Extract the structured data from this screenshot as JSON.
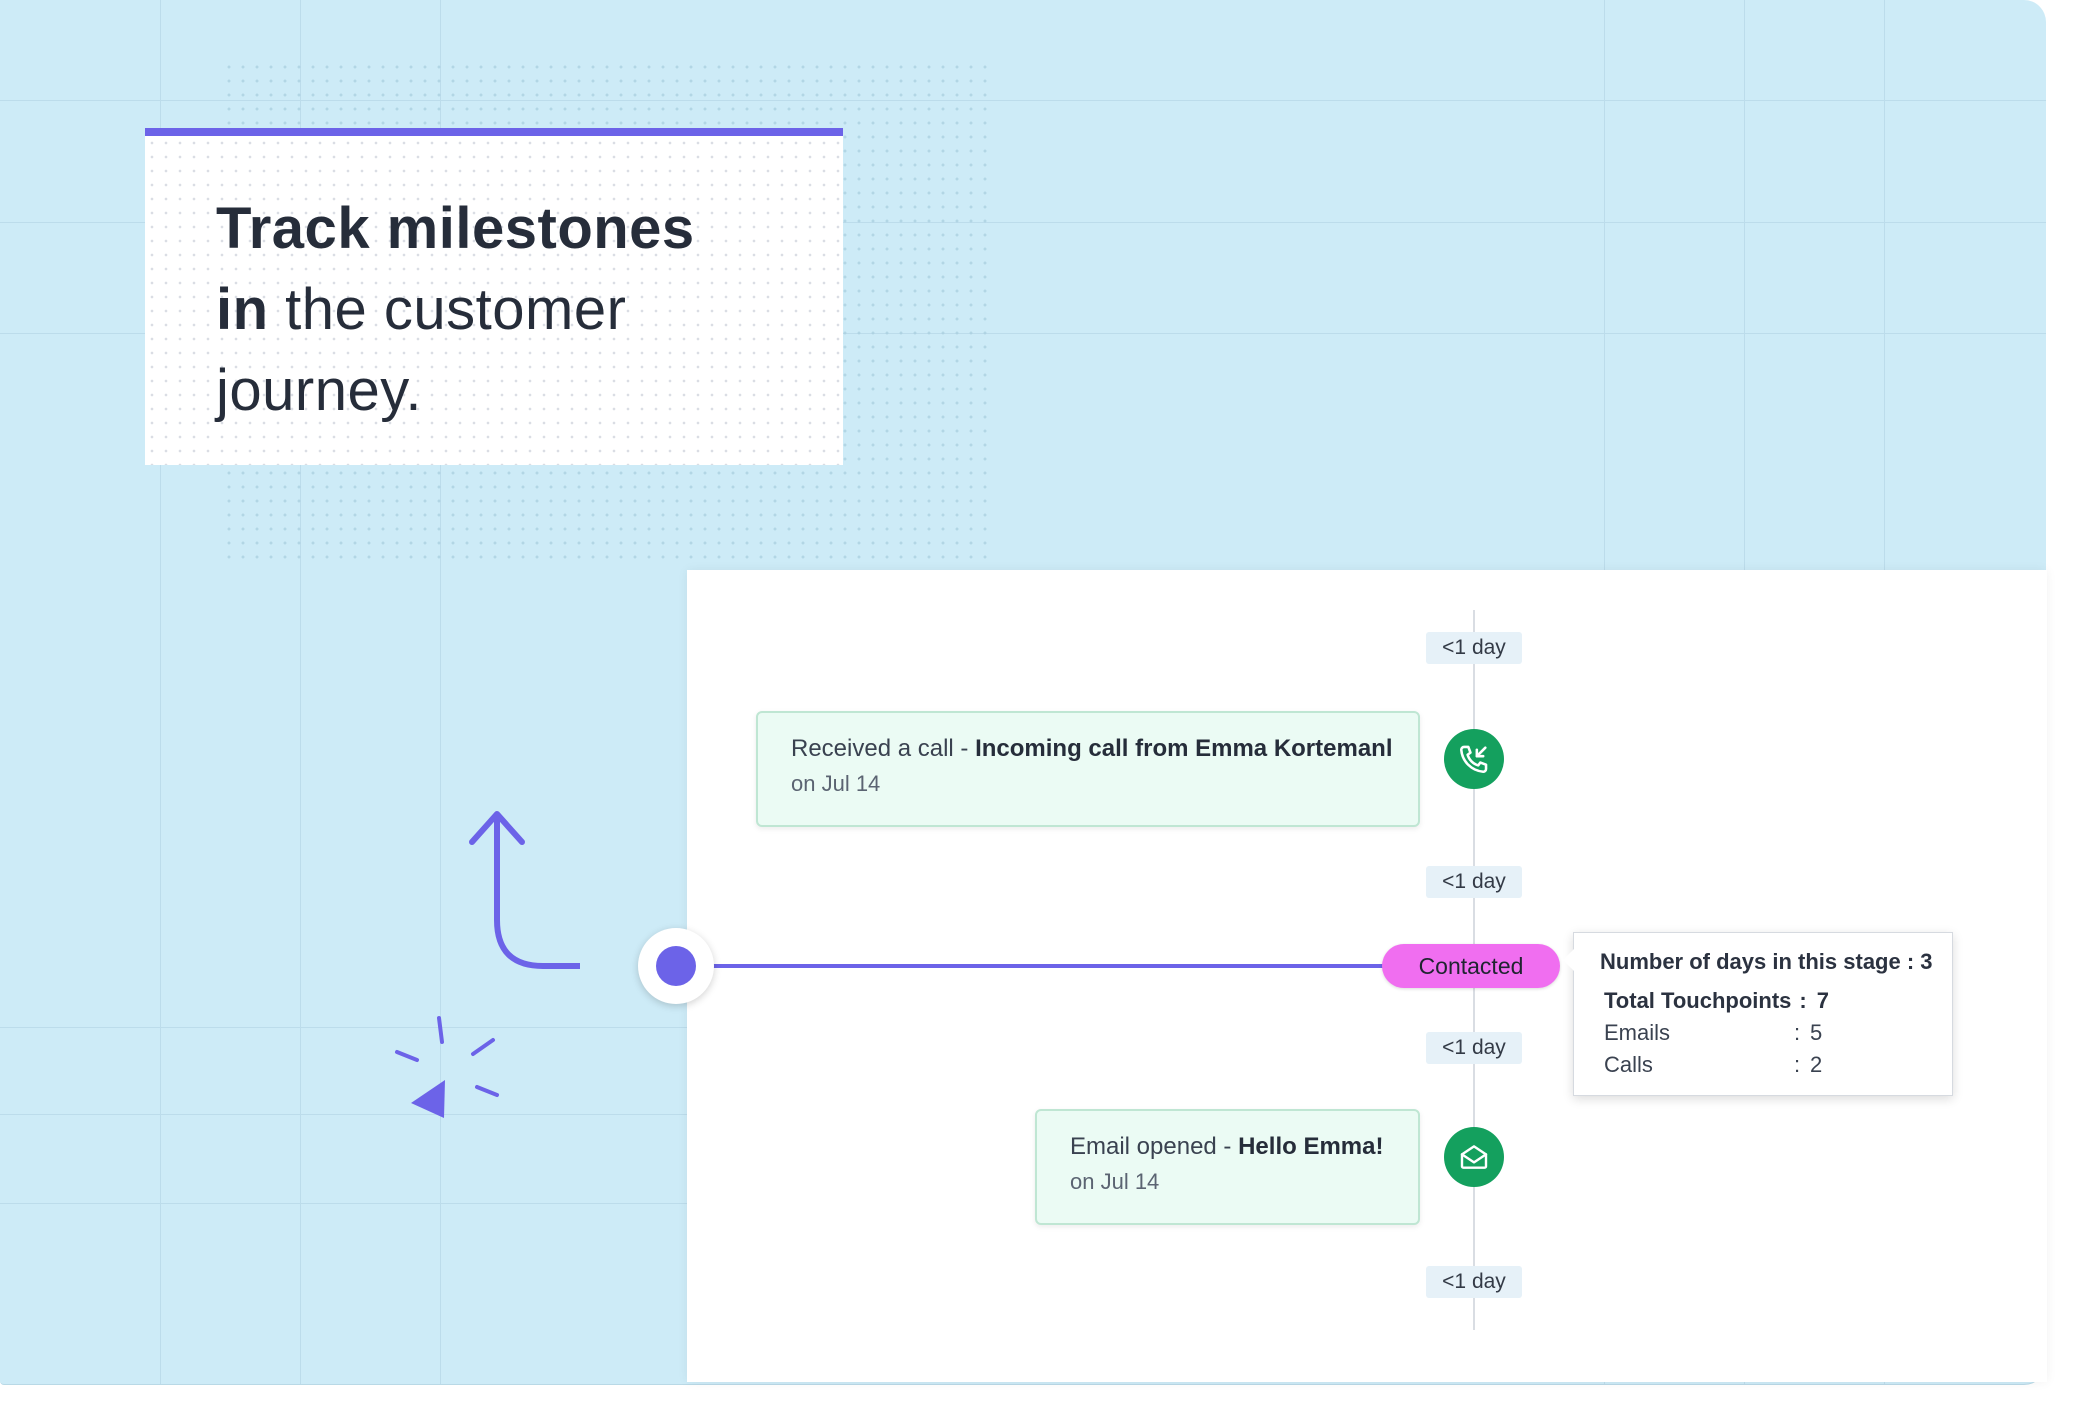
{
  "hero": {
    "title_line1": "Track milestones",
    "title_line2_bold": "in",
    "title_line2_rest": " the customer",
    "title_line3": "journey."
  },
  "timeline": {
    "gap_labels": [
      "<1 day",
      "<1 day",
      "<1 day",
      "<1 day"
    ],
    "events": [
      {
        "prefix": "Received a call - ",
        "bold": "Incoming call from Emma Kortemanl",
        "date": "on Jul 14",
        "icon": "incoming-call-icon"
      },
      {
        "prefix": "Email opened - ",
        "bold": "Hello Emma!",
        "date": "on Jul 14",
        "icon": "email-opened-icon"
      }
    ],
    "stage": {
      "label": "Contacted",
      "color": "#f06ef0"
    }
  },
  "stage_tooltip": {
    "heading": "Number of days in this stage : 3",
    "touchpoints_label": "Total Touchpoints",
    "touchpoints_value": "7",
    "rows": [
      {
        "label": "Emails",
        "value": "5"
      },
      {
        "label": "Calls",
        "value": "2"
      }
    ],
    "separator": ":"
  },
  "colors": {
    "accent": "#6c63e8",
    "event_icon": "#14a05e",
    "background": "#cdebf7"
  }
}
